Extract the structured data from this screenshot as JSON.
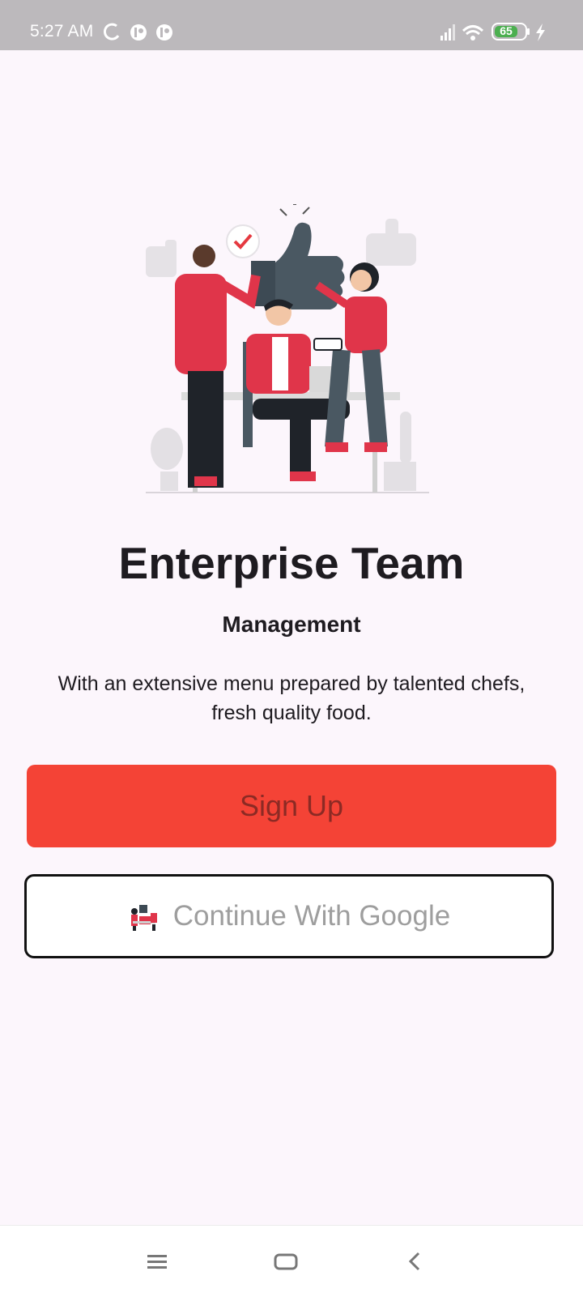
{
  "status_bar": {
    "time": "5:27 AM",
    "battery_level": "65",
    "icons": [
      "sync-icon",
      "notification-icon",
      "notification-icon",
      "signal-icon",
      "wifi-icon",
      "battery-icon",
      "charging-icon"
    ]
  },
  "hero": {
    "title": "Enterprise Team",
    "subtitle": "Management",
    "description": "With an extensive menu prepared by talented chefs, fresh quality food."
  },
  "actions": {
    "signup_label": "Sign Up",
    "google_label": "Continue With Google"
  },
  "nav_bar": {
    "icons": [
      "menu-icon",
      "home-icon",
      "back-icon"
    ]
  },
  "colors": {
    "background": "#fcf6fc",
    "accent": "#f44336",
    "text": "#1e1b20",
    "status_bar": "#bcb9bc"
  }
}
